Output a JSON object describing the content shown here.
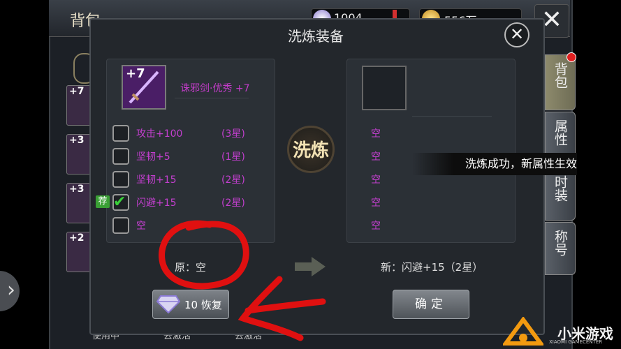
{
  "bag": {
    "title": "背包",
    "currency": [
      {
        "value": "1004",
        "icon": "gem-icon"
      },
      {
        "value": "556万",
        "icon": "gold-coin-icon"
      }
    ],
    "bottom_labels": [
      "使用中",
      "去激活",
      "去激活"
    ],
    "item_levels": [
      "+7",
      "+3",
      "+3",
      "+2"
    ]
  },
  "side_tabs": [
    {
      "label": "背包",
      "active": true
    },
    {
      "label": "属性",
      "active": false
    },
    {
      "label": "时装",
      "active": false
    },
    {
      "label": "称号",
      "active": false
    }
  ],
  "dialog": {
    "title": "洗炼装备",
    "item": {
      "level": "+7",
      "name": "诛邪剑·优秀 +7",
      "icon": "sword-icon"
    },
    "attributes": [
      {
        "text": "攻击+100",
        "stars": "(3星)",
        "checked": false
      },
      {
        "text": "坚韧+5",
        "stars": "(1星)",
        "checked": false
      },
      {
        "text": "坚韧+15",
        "stars": "(2星)",
        "checked": false
      },
      {
        "text": "闪避+15",
        "stars": "(2星)",
        "checked": true,
        "recommended": true
      },
      {
        "text": "空",
        "stars": "",
        "checked": false
      }
    ],
    "recommend_badge": "荐",
    "new_attributes": [
      "空",
      "空",
      "空",
      "空",
      "空"
    ],
    "wash_button": "洗炼",
    "original_label": "原：空",
    "new_label": "新：闪避+15（2星）",
    "restore_button": {
      "cost": "10",
      "label": "恢复",
      "icon": "diamond-icon"
    },
    "confirm_button": "确定"
  },
  "toast": "洗炼成功，新属性生效",
  "watermark": {
    "text": "小米游戏",
    "sub": "XIAOMI GAMECENTER"
  },
  "colors": {
    "attribute_purple": "#c33fcf",
    "annotation_red": "#e01010",
    "check_green": "#3ad03a"
  }
}
